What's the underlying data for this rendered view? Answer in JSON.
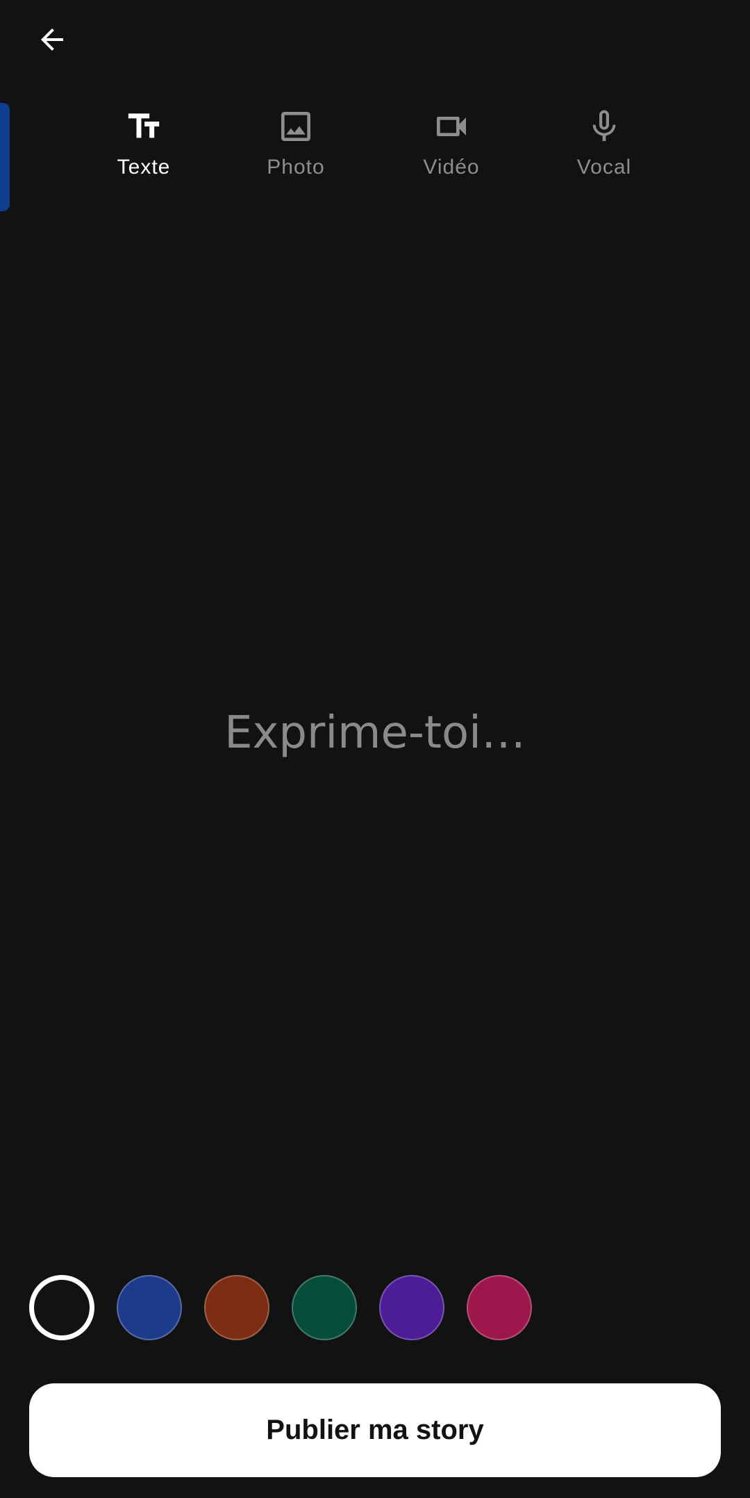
{
  "header": {
    "back_icon": "arrow-left-icon"
  },
  "tabs": [
    {
      "label": "Texte",
      "icon": "text-format-icon",
      "active": true
    },
    {
      "label": "Photo",
      "icon": "image-icon",
      "active": false
    },
    {
      "label": "Vidéo",
      "icon": "video-camera-icon",
      "active": false
    },
    {
      "label": "Vocal",
      "icon": "microphone-icon",
      "active": false
    }
  ],
  "editor": {
    "placeholder": "Exprime-toi…",
    "value": ""
  },
  "background_colors": [
    {
      "name": "black",
      "hex": "#121212",
      "selected": true
    },
    {
      "name": "blue",
      "hex": "#1e3a8a",
      "selected": false
    },
    {
      "name": "orange",
      "hex": "#7c2d12",
      "selected": false
    },
    {
      "name": "green",
      "hex": "#064e3b",
      "selected": false
    },
    {
      "name": "purple",
      "hex": "#4c1d95",
      "selected": false
    },
    {
      "name": "pink",
      "hex": "#9d174d",
      "selected": false
    }
  ],
  "publish_button": {
    "label": "Publier ma story"
  },
  "colors": {
    "background": "#121212",
    "accent_indicator": "#0f3d8f",
    "inactive_tab": "#8e8e8e",
    "active_tab": "#ffffff"
  }
}
